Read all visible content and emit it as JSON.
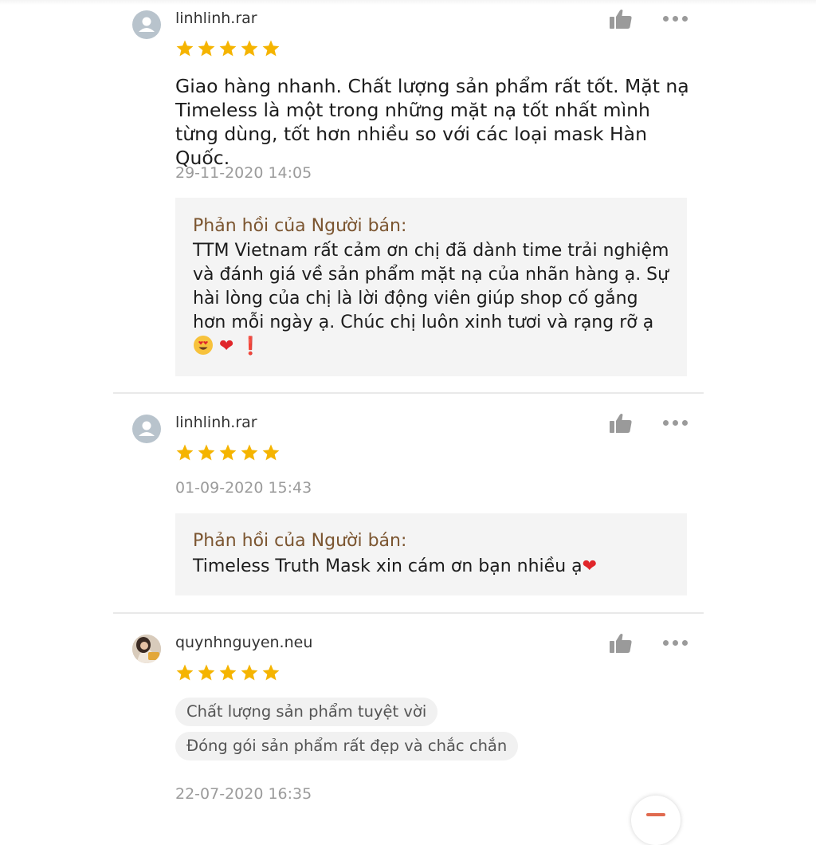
{
  "reviews": [
    {
      "username": "linhlinh.rar",
      "rating": 5,
      "comment": "Giao hàng nhanh. Chất lượng sản phẩm rất tốt. Mặt nạ Timeless là một trong những mặt nạ tốt nhất mình từng dùng, tốt hơn nhiều so với các loại mask Hàn Quốc.",
      "timestamp": "29-11-2020 14:05",
      "seller_reply": {
        "title": "Phản hồi của Người bán:",
        "text": "TTM Vietnam rất cảm ơn chị đã dành time trải nghiệm và đánh giá về sản phẩm mặt nạ của nhãn hàng ạ. Sự hài lòng của chị là lời động viên giúp shop cố gắng hơn mỗi ngày ạ. Chúc chị luôn xinh tươi và rạng rỡ ạ",
        "emoji_heart": "❤",
        "emoji_exclaim": "❗"
      }
    },
    {
      "username": "linhlinh.rar",
      "rating": 5,
      "timestamp": "01-09-2020 15:43",
      "seller_reply": {
        "title": "Phản hồi của Người bán:",
        "text": "Timeless Truth Mask xin cám ơn bạn nhiều ạ",
        "emoji_heart": "❤"
      }
    },
    {
      "username": "quynhnguyen.neu",
      "rating": 5,
      "tags": [
        "Chất lượng sản phẩm tuyệt vời",
        "Đóng gói sản phẩm rất đẹp và chắc chắn"
      ],
      "timestamp": "22-07-2020 16:35"
    }
  ],
  "icons": {
    "avatar_default": "user-icon",
    "like": "thumbs-up-icon",
    "more": "more-options-icon",
    "star": "star-icon",
    "scroll_button": "scroll-button-icon"
  },
  "colors": {
    "star": "#f5b400",
    "seller_reply_title": "#7b5530",
    "timestamp": "#9b9b9b",
    "reply_background": "#f4f4f4",
    "heart": "#e0262a"
  }
}
